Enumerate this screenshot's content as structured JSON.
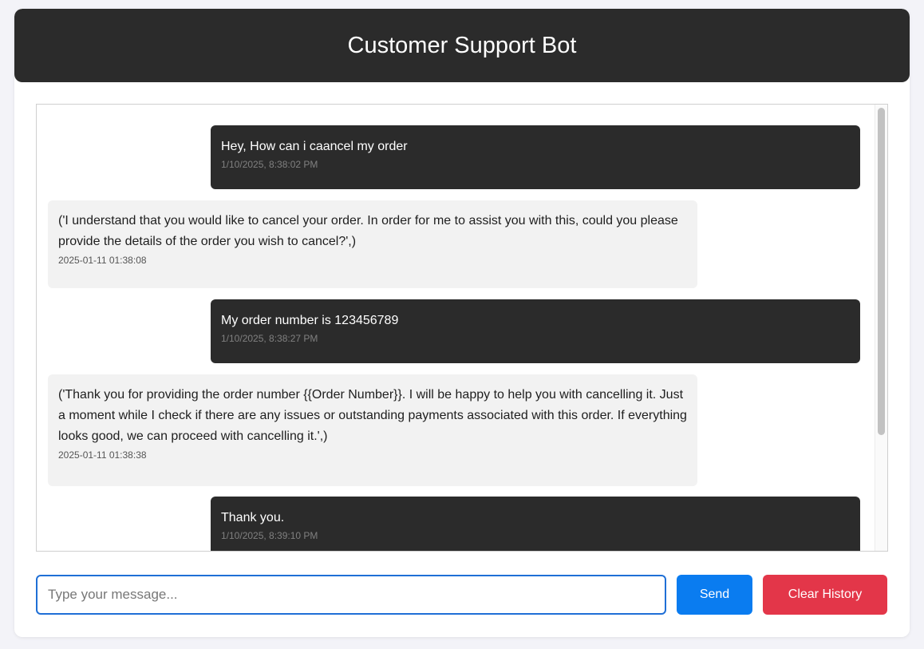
{
  "header": {
    "title": "Customer Support Bot"
  },
  "messages": [
    {
      "role": "user",
      "text": "Hey, How can i caancel my order",
      "time": "1/10/2025, 8:38:02 PM"
    },
    {
      "role": "bot",
      "text": "('I understand that you would like to cancel your order. In order for me to assist you with this, could you please provide the details of the order you wish to cancel?',)",
      "time": "2025-01-11 01:38:08"
    },
    {
      "role": "user",
      "text": "My order number is 123456789",
      "time": "1/10/2025, 8:38:27 PM"
    },
    {
      "role": "bot",
      "text": "('Thank you for providing the order number {{Order Number}}. I will be happy to help you with cancelling it. Just a moment while I check if there are any issues or outstanding payments associated with this order. If everything looks good, we can proceed with cancelling it.',)",
      "time": "2025-01-11 01:38:38"
    },
    {
      "role": "user",
      "text": "Thank you.",
      "time": "1/10/2025, 8:39:10 PM"
    }
  ],
  "input": {
    "placeholder": "Type your message...",
    "value": ""
  },
  "buttons": {
    "send_label": "Send",
    "clear_label": "Clear History"
  },
  "colors": {
    "header_bg": "#2b2b2b",
    "user_bubble": "#2b2b2b",
    "bot_bubble": "#f2f2f2",
    "send_button": "#0a7cf0",
    "clear_button": "#e33649",
    "input_border": "#1f6fd6"
  }
}
